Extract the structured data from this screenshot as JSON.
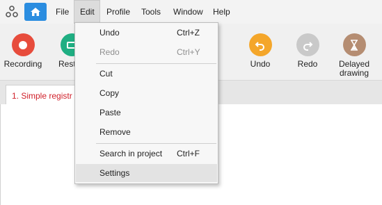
{
  "menubar": {
    "items": [
      "File",
      "Edit",
      "Profile",
      "Tools",
      "Window",
      "Help"
    ],
    "active": "Edit"
  },
  "toolbar": {
    "recording": "Recording",
    "restore_partial": "Rest",
    "undo": "Undo",
    "redo": "Redo",
    "delayed_drawing_line1": "Delayed",
    "delayed_drawing_line2": "drawing",
    "colors": {
      "recording": "#e74c3c",
      "restore": "#1fae82",
      "undo": "#f4a62a",
      "redo": "#c9c9c9",
      "delayed": "#b58d72",
      "home": "#2b8de0"
    }
  },
  "tabs": {
    "doc_tab": "1. Simple registr"
  },
  "edit_menu": {
    "undo": {
      "label": "Undo",
      "shortcut": "Ctrl+Z"
    },
    "redo": {
      "label": "Redo",
      "shortcut": "Ctrl+Y"
    },
    "cut": {
      "label": "Cut"
    },
    "copy": {
      "label": "Copy"
    },
    "paste": {
      "label": "Paste"
    },
    "remove": {
      "label": "Remove"
    },
    "search": {
      "label": "Search in project",
      "shortcut": "Ctrl+F"
    },
    "settings": {
      "label": "Settings"
    }
  }
}
